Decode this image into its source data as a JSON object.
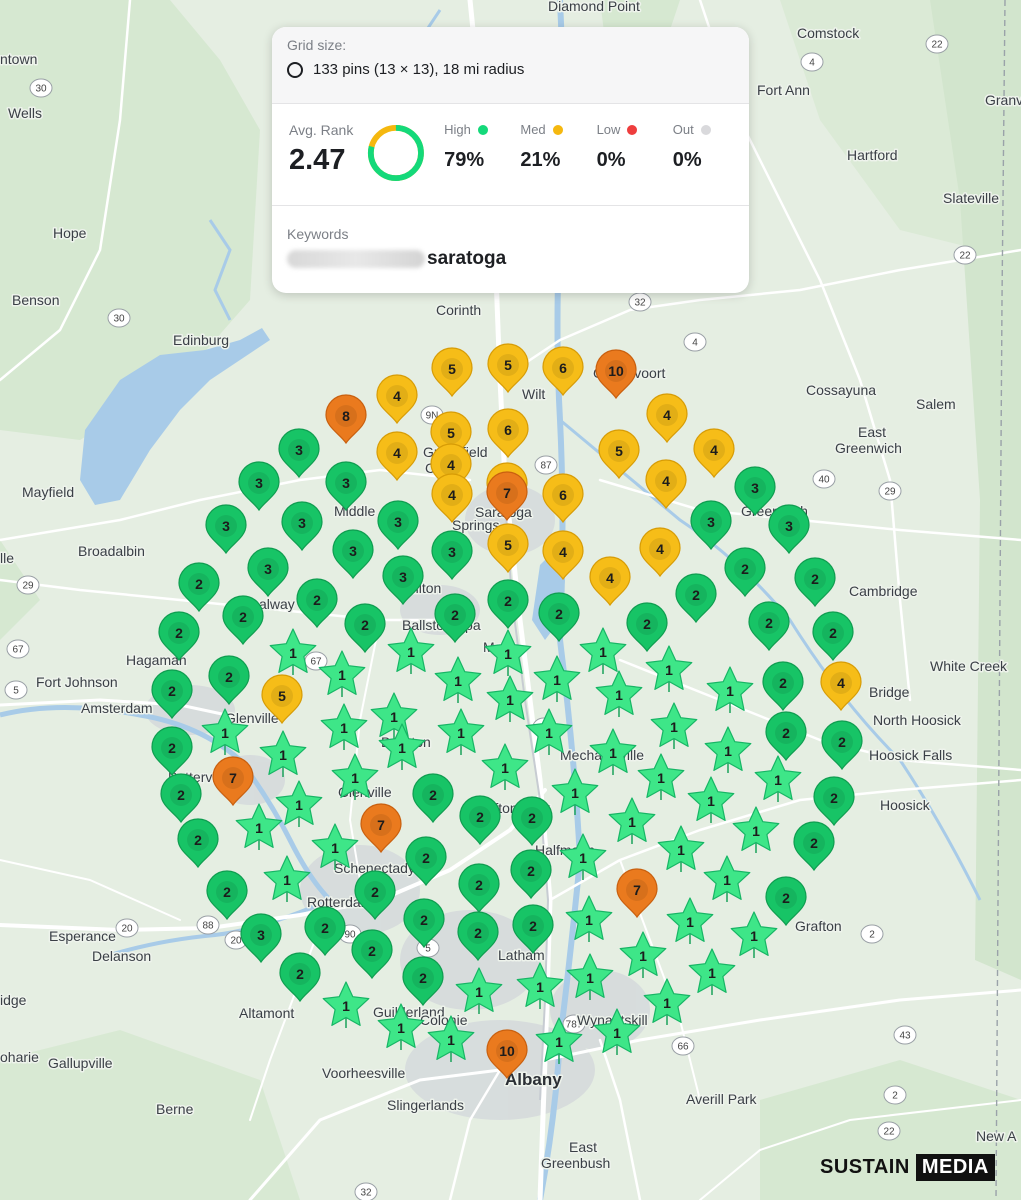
{
  "summary": {
    "grid_size_label": "Grid size:",
    "grid_size_value": "133 pins (13 × 13), 18 mi radius",
    "avg_rank_label": "Avg. Rank",
    "avg_rank_value": "2.47",
    "stats": [
      {
        "label": "High",
        "value": "79%",
        "color": "#14d97a"
      },
      {
        "label": "Med",
        "value": "21%",
        "color": "#f5b80f"
      },
      {
        "label": "Low",
        "value": "0%",
        "color": "#ee3d3d"
      },
      {
        "label": "Out",
        "value": "0%",
        "color": "#d9d9dc"
      }
    ],
    "donut_fraction_high": 0.79,
    "keywords_label": "Keywords",
    "keyword_visible": "saratoga"
  },
  "brand": {
    "word1": "SUSTAIN",
    "word2": "MEDIA"
  },
  "colors": {
    "star": "#3ee688",
    "high_pin": "#17c466",
    "med_pin": "#f6bd18",
    "low_pin": "#ea7a1e",
    "map_bg": "#e6eee3",
    "water": "#a9cdea",
    "urban": "#d3d7db"
  },
  "towns": [
    {
      "name": "Diamond Point"
    },
    {
      "name": "Comstock"
    },
    {
      "name": "ntown"
    },
    {
      "name": "Wells"
    },
    {
      "name": "Fort Ann"
    },
    {
      "name": "Granvil"
    },
    {
      "name": "Hartford"
    },
    {
      "name": "Slateville"
    },
    {
      "name": "Hope"
    },
    {
      "name": "Benson"
    },
    {
      "name": "Corinth"
    },
    {
      "name": "Edinburg"
    },
    {
      "name": "Gansevoort"
    },
    {
      "name": "Cossayuna"
    },
    {
      "name": "Salem"
    },
    {
      "name": "East"
    },
    {
      "name": "Greenwich"
    },
    {
      "name": "Mayfield"
    },
    {
      "name": "Wilt"
    },
    {
      "name": "Greenfield"
    },
    {
      "name": "Center"
    },
    {
      "name": "Middle"
    },
    {
      "name": "Saratoga"
    },
    {
      "name": "Springs"
    },
    {
      "name": "Greenwich"
    },
    {
      "name": "Broadalbin"
    },
    {
      "name": "lle"
    },
    {
      "name": "Milton"
    },
    {
      "name": "alway"
    },
    {
      "name": "Ballston Spa"
    },
    {
      "name": "Cambridge"
    },
    {
      "name": "Hagaman"
    },
    {
      "name": "Malta"
    },
    {
      "name": "White Creek"
    },
    {
      "name": "Fort Johnson"
    },
    {
      "name": "Amsterdam"
    },
    {
      "name": "Bridge"
    },
    {
      "name": "North Hoosick"
    },
    {
      "name": "Glenville"
    },
    {
      "name": "Ballston"
    },
    {
      "name": "Mechanicville"
    },
    {
      "name": "Hoosick Falls"
    },
    {
      "name": "Patterville"
    },
    {
      "name": "Glenville"
    },
    {
      "name": "Clifton Park"
    },
    {
      "name": "Hoosick"
    },
    {
      "name": "Halfmoon"
    },
    {
      "name": "Schenectady"
    },
    {
      "name": "Rotterdam"
    },
    {
      "name": "Grafton"
    },
    {
      "name": "Esperance"
    },
    {
      "name": "Delanson"
    },
    {
      "name": "Latham"
    },
    {
      "name": "idge"
    },
    {
      "name": "Altamont"
    },
    {
      "name": "Guilderland"
    },
    {
      "name": "Colonie"
    },
    {
      "name": "Wynantskill"
    },
    {
      "name": "oharie"
    },
    {
      "name": "Gallupville"
    },
    {
      "name": "Voorheesville"
    },
    {
      "name": "Albany"
    },
    {
      "name": "Berne"
    },
    {
      "name": "Averill Park"
    },
    {
      "name": "Slingerlands"
    },
    {
      "name": "East"
    },
    {
      "name": "Greenbush"
    },
    {
      "name": "New A"
    }
  ],
  "shields": [
    "22",
    "4",
    "30",
    "30",
    "9N",
    "87",
    "40",
    "32",
    "4",
    "29",
    "67",
    "5",
    "67",
    "40",
    "29",
    "4",
    "88",
    "20",
    "90",
    "5",
    "20",
    "787",
    "66",
    "43",
    "22",
    "2",
    "2",
    "32",
    "22"
  ],
  "pins": [
    {
      "rank": 4
    },
    {
      "rank": 5
    },
    {
      "rank": 5
    },
    {
      "rank": 6
    },
    {
      "rank": 10
    },
    {
      "rank": 8
    },
    {
      "rank": 4
    },
    {
      "rank": 5
    },
    {
      "rank": 6
    },
    {
      "rank": 4
    },
    {
      "rank": 3
    },
    {
      "rank": 4
    },
    {
      "rank": 4
    },
    {
      "rank": 5
    },
    {
      "rank": 4
    },
    {
      "rank": 3
    },
    {
      "rank": 3
    },
    {
      "rank": 4
    },
    {
      "rank": 7
    },
    {
      "rank": 6
    },
    {
      "rank": 4
    },
    {
      "rank": 3
    },
    {
      "rank": 3
    },
    {
      "rank": 3
    },
    {
      "rank": 3
    },
    {
      "rank": 5
    },
    {
      "rank": 4
    },
    {
      "rank": 4
    },
    {
      "rank": 3
    },
    {
      "rank": 3
    },
    {
      "rank": 3
    },
    {
      "rank": 3
    },
    {
      "rank": 3
    },
    {
      "rank": 4
    },
    {
      "rank": 2
    },
    {
      "rank": 2
    },
    {
      "rank": 2
    },
    {
      "rank": 2
    },
    {
      "rank": 3
    },
    {
      "rank": 2
    },
    {
      "rank": 2
    },
    {
      "rank": 2
    },
    {
      "rank": 2
    },
    {
      "rank": 2
    },
    {
      "rank": 2
    },
    {
      "rank": 2
    },
    {
      "rank": 2
    },
    {
      "rank": 2
    },
    {
      "rank": 2
    },
    {
      "rank": 1
    },
    {
      "rank": 1
    },
    {
      "rank": 1
    },
    {
      "rank": 1
    },
    {
      "rank": 1
    },
    {
      "rank": 2
    },
    {
      "rank": 5
    },
    {
      "rank": 1
    },
    {
      "rank": 1
    },
    {
      "rank": 1
    },
    {
      "rank": 1
    },
    {
      "rank": 1
    },
    {
      "rank": 1
    },
    {
      "rank": 2
    },
    {
      "rank": 4
    },
    {
      "rank": 2
    },
    {
      "rank": 1
    },
    {
      "rank": 1
    },
    {
      "rank": 1
    },
    {
      "rank": 1
    },
    {
      "rank": 1
    },
    {
      "rank": 1
    },
    {
      "rank": 1
    },
    {
      "rank": 1
    },
    {
      "rank": 2
    },
    {
      "rank": 2
    },
    {
      "rank": 7
    },
    {
      "rank": 1
    },
    {
      "rank": 1
    },
    {
      "rank": 1
    },
    {
      "rank": 1
    },
    {
      "rank": 1
    },
    {
      "rank": 1
    },
    {
      "rank": 2
    },
    {
      "rank": 1
    },
    {
      "rank": 2
    },
    {
      "rank": 1
    },
    {
      "rank": 1
    },
    {
      "rank": 2
    },
    {
      "rank": 2
    },
    {
      "rank": 1
    },
    {
      "rank": 7
    },
    {
      "rank": 2
    },
    {
      "rank": 2
    },
    {
      "rank": 1
    },
    {
      "rank": 1
    },
    {
      "rank": 1
    },
    {
      "rank": 2
    },
    {
      "rank": 2
    },
    {
      "rank": 1
    },
    {
      "rank": 1
    },
    {
      "rank": 2
    },
    {
      "rank": 2
    },
    {
      "rank": 1
    },
    {
      "rank": 7
    },
    {
      "rank": 1
    },
    {
      "rank": 2
    },
    {
      "rank": 2
    },
    {
      "rank": 2
    },
    {
      "rank": 2
    },
    {
      "rank": 2
    },
    {
      "rank": 1
    },
    {
      "rank": 1
    },
    {
      "rank": 1
    },
    {
      "rank": 3
    },
    {
      "rank": 2
    },
    {
      "rank": 2
    },
    {
      "rank": 2
    },
    {
      "rank": 1
    },
    {
      "rank": 1
    },
    {
      "rank": 2
    },
    {
      "rank": 2
    },
    {
      "rank": 2
    },
    {
      "rank": 1
    },
    {
      "rank": 1
    },
    {
      "rank": 1
    },
    {
      "rank": 1
    },
    {
      "rank": 1
    },
    {
      "rank": 1
    },
    {
      "rank": 1
    },
    {
      "rank": 10
    },
    {
      "rank": 1
    },
    {
      "rank": 1
    }
  ]
}
